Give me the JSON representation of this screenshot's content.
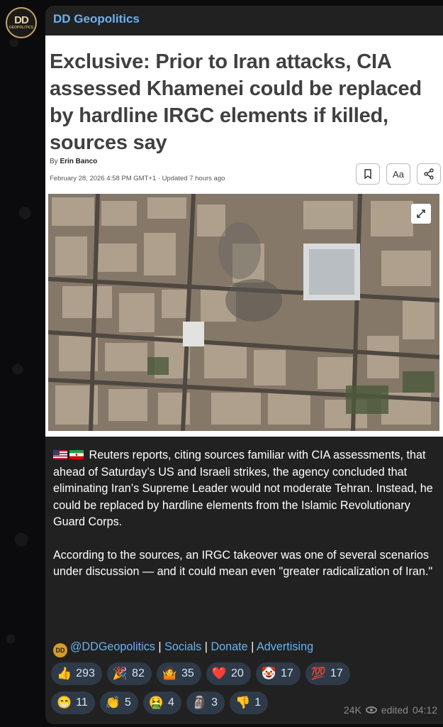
{
  "channel": {
    "name": "DD Geopolitics",
    "avatar_text": "DD",
    "avatar_subtext": "GEOPOLITICS"
  },
  "article": {
    "headline": "Exclusive: Prior to Iran attacks, CIA assessed Khamenei could be replaced by hardline IRGC elements if killed, sources say",
    "byline_prefix": "By",
    "author": "Erin Banco",
    "dateline": "February 28, 2026 4:58 PM GMT+1 · Updated 7 hours ago",
    "font_button_label": "Aa",
    "icons": [
      "bookmark-icon",
      "share-icon",
      "expand-icon"
    ]
  },
  "post": {
    "paragraph1": "Reuters reports, citing sources familiar with CIA assessments, that ahead of Saturday’s US and Israeli strikes, the agency concluded that eliminating Iran’s Supreme Leader would not moderate Tehran. Instead, he could be replaced by hardline elements from the Islamic Revolutionary Guard Corps.",
    "paragraph2": "According to the sources, an IRGC takeover was one of several scenarios under discussion — and it could mean even \"greater radicalization of Iran.\"",
    "links": {
      "handle": "@DDGeopolitics",
      "sep": " | ",
      "socials": "Socials",
      "donate": "Donate",
      "advertising": "Advertising"
    }
  },
  "reactions": [
    {
      "emoji": "👍",
      "count": "293"
    },
    {
      "emoji": "🎉",
      "count": "82"
    },
    {
      "emoji": "🤷",
      "count": "35"
    },
    {
      "emoji": "❤️",
      "count": "20"
    },
    {
      "emoji": "🤡",
      "count": "17"
    },
    {
      "emoji": "💯",
      "count": "17"
    },
    {
      "emoji": "😁",
      "count": "11"
    },
    {
      "emoji": "👏",
      "count": "5"
    },
    {
      "emoji": "🤮",
      "count": "4"
    },
    {
      "emoji": "🗿",
      "count": "3"
    },
    {
      "emoji": "👎",
      "count": "1"
    }
  ],
  "meta": {
    "views": "24K",
    "edited_label": "edited",
    "time": "04:12"
  }
}
